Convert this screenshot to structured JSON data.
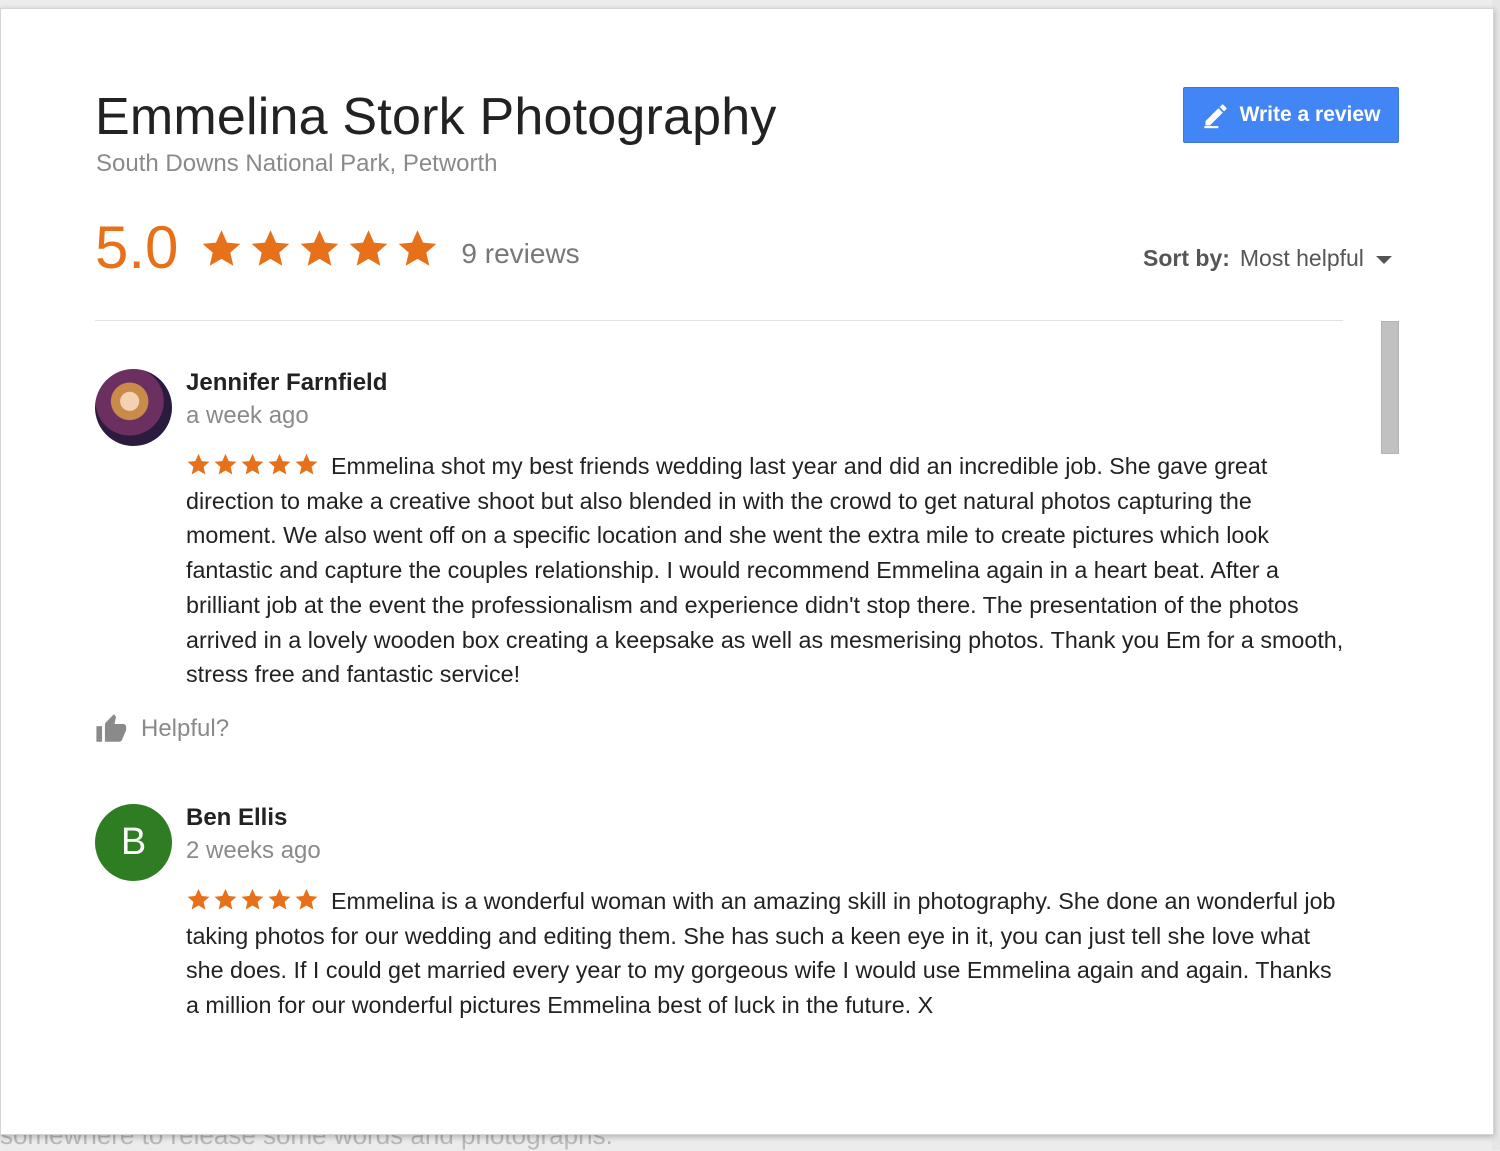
{
  "background": {
    "text": "somewhere to release some words and photographs."
  },
  "business": {
    "name": "Emmelina Stork Photography",
    "address": "South Downs National Park, Petworth"
  },
  "write_review_button": {
    "label": "Write a review",
    "icon": "pencil-icon",
    "color": "#4285f4"
  },
  "rating": {
    "value": "5.0",
    "stars": 5,
    "count_text": "9 reviews",
    "accent_color": "#e7711b"
  },
  "sort": {
    "label": "Sort by:",
    "value": "Most helpful"
  },
  "reviews": [
    {
      "author": "Jennifer Farnfield",
      "time": "a week ago",
      "stars": 5,
      "text": "Emmelina shot my best friends wedding last year and did an incredible job. She gave great direction to make a creative shoot but also blended in with the crowd to get natural photos capturing the moment. We also went off on a specific location and she went the extra mile to create pictures which look fantastic and capture the couples relationship. I would recommend Emmelina again in a heart beat. After a brilliant job at the event the professionalism and experience didn't stop there. The presentation of the photos arrived in a lovely wooden box creating a keepsake as well as mesmerising photos. Thank you Em for a smooth, stress free and fantastic service!",
      "helpful_label": "Helpful?",
      "avatar": "photo"
    },
    {
      "author": "Ben Ellis",
      "time": "2 weeks ago",
      "stars": 5,
      "text": "Emmelina is a wonderful woman with an amazing skill in photography. She done an wonderful job taking photos for our wedding and editing them. She has such a keen eye in it, you can just tell she love what she does. If I could get married every year to my gorgeous wife I would use Emmelina again and again. Thanks a million for our wonderful pictures Emmelina best of luck in the future. X",
      "avatar_letter": "B",
      "avatar_color": "#2e7d22"
    }
  ]
}
